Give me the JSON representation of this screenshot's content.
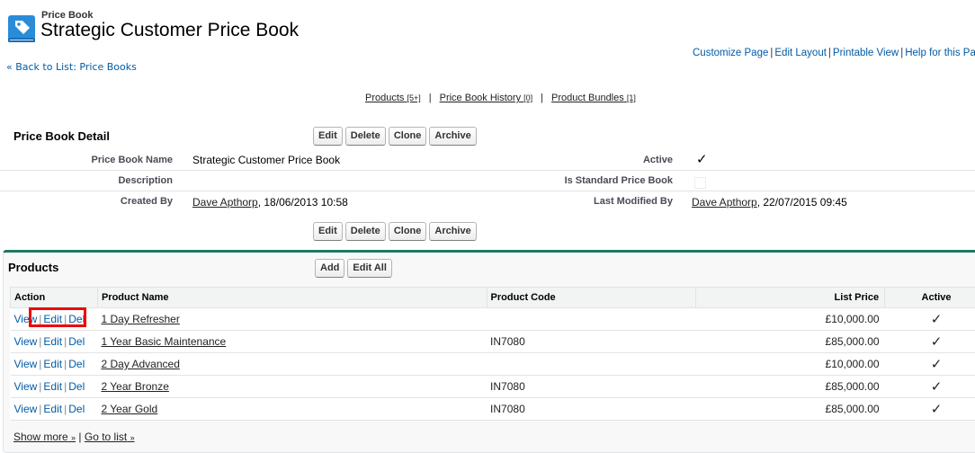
{
  "header": {
    "object_type": "Price Book",
    "title": "Strategic Customer Price Book",
    "icon": "price-tag-book-icon",
    "brand_color": "#2a8cd8"
  },
  "back_link": "« Back to List: Price Books",
  "top_links": [
    "Customize Page",
    "Edit Layout",
    "Printable View",
    "Help for this Page"
  ],
  "related_links": [
    {
      "label": "Products",
      "count": "[5+]"
    },
    {
      "label": "Price Book History",
      "count": "[0]"
    },
    {
      "label": "Product Bundles",
      "count": "[1]"
    }
  ],
  "detail": {
    "title": "Price Book Detail",
    "buttons": [
      "Edit",
      "Delete",
      "Clone",
      "Archive"
    ],
    "fields": {
      "price_book_name_label": "Price Book Name",
      "price_book_name": "Strategic Customer Price Book",
      "description_label": "Description",
      "description": "",
      "created_by_label": "Created By",
      "created_by_user": "Dave Apthorp",
      "created_by_date": ", 18/06/2013 10:58",
      "active_label": "Active",
      "active": true,
      "is_standard_label": "Is Standard Price Book",
      "is_standard": false,
      "last_modified_label": "Last Modified By",
      "last_modified_user": "Dave Apthorp",
      "last_modified_date": ", 22/07/2015 09:45"
    }
  },
  "products": {
    "title": "Products",
    "buttons": [
      "Add",
      "Edit All"
    ],
    "columns": [
      "Action",
      "Product Name",
      "Product Code",
      "List Price",
      "Active"
    ],
    "action_labels": [
      "View",
      "Edit",
      "Del"
    ],
    "rows": [
      {
        "name": "1 Day Refresher",
        "code": "",
        "price": "£10,000.00",
        "active": "✓"
      },
      {
        "name": "1 Year Basic Maintenance",
        "code": "IN7080",
        "price": "£85,000.00",
        "active": "✓"
      },
      {
        "name": "2 Day Advanced",
        "code": "",
        "price": "£10,000.00",
        "active": "✓"
      },
      {
        "name": "2 Year Bronze",
        "code": "IN7080",
        "price": "£85,000.00",
        "active": "✓"
      },
      {
        "name": "2 Year Gold",
        "code": "IN7080",
        "price": "£85,000.00",
        "active": "✓"
      }
    ],
    "show_more": "Show more",
    "go_to_list": "Go to list",
    "highlight_color": "#e00000",
    "accent_color": "#1f7862"
  },
  "check_glyph": "✓"
}
